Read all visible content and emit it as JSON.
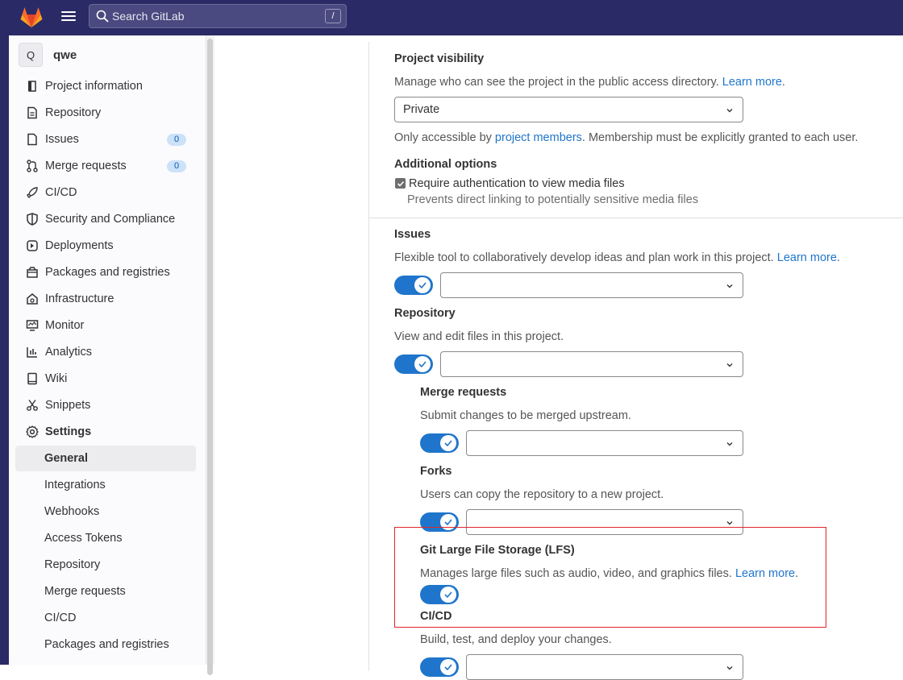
{
  "topbar": {
    "search_placeholder": "Search GitLab",
    "search_shortcut": "/"
  },
  "project": {
    "avatar_letter": "Q",
    "name": "qwe"
  },
  "sidebar": {
    "items": [
      {
        "label": "Project information",
        "icon": "info-icon"
      },
      {
        "label": "Repository",
        "icon": "doc-icon"
      },
      {
        "label": "Issues",
        "icon": "issues-icon",
        "badge": "0"
      },
      {
        "label": "Merge requests",
        "icon": "merge-icon",
        "badge": "0"
      },
      {
        "label": "CI/CD",
        "icon": "rocket-icon"
      },
      {
        "label": "Security and Compliance",
        "icon": "shield-icon"
      },
      {
        "label": "Deployments",
        "icon": "deploy-icon"
      },
      {
        "label": "Packages and registries",
        "icon": "package-icon"
      },
      {
        "label": "Infrastructure",
        "icon": "cloud-icon"
      },
      {
        "label": "Monitor",
        "icon": "monitor-icon"
      },
      {
        "label": "Analytics",
        "icon": "chart-icon"
      },
      {
        "label": "Wiki",
        "icon": "book-icon"
      },
      {
        "label": "Snippets",
        "icon": "scissors-icon"
      },
      {
        "label": "Settings",
        "icon": "gear-icon"
      }
    ],
    "settings_sub": [
      {
        "label": "General",
        "active": true
      },
      {
        "label": "Integrations"
      },
      {
        "label": "Webhooks"
      },
      {
        "label": "Access Tokens"
      },
      {
        "label": "Repository"
      },
      {
        "label": "Merge requests"
      },
      {
        "label": "CI/CD"
      },
      {
        "label": "Packages and registries"
      }
    ]
  },
  "visibility": {
    "title": "Project visibility",
    "desc": "Manage who can see the project in the public access directory.",
    "learn_more": "Learn more",
    "period": ".",
    "selected": "Private",
    "note_prefix": "Only accessible by ",
    "note_link": "project members",
    "note_suffix": ". Membership must be explicitly granted to each user."
  },
  "additional": {
    "title": "Additional options",
    "checkbox_label": "Require authentication to view media files",
    "checkbox_help": "Prevents direct linking to potentially sensitive media files",
    "checked": true
  },
  "features": {
    "issues": {
      "title": "Issues",
      "desc": "Flexible tool to collaboratively develop ideas and plan work in this project.",
      "learn_more": "Learn more",
      "period": "."
    },
    "repository": {
      "title": "Repository",
      "desc": "View and edit files in this project."
    },
    "merge_requests": {
      "title": "Merge requests",
      "desc": "Submit changes to be merged upstream."
    },
    "forks": {
      "title": "Forks",
      "desc": "Users can copy the repository to a new project."
    },
    "lfs": {
      "title": "Git Large File Storage (LFS)",
      "desc": "Manages large files such as audio, video, and graphics files.",
      "learn_more": "Learn more",
      "period": "."
    },
    "cicd": {
      "title": "CI/CD",
      "desc": "Build, test, and deploy your changes."
    }
  },
  "colors": {
    "accent": "#1f75cb",
    "topbar": "#2a2a66",
    "highlight": "#e0252b"
  }
}
